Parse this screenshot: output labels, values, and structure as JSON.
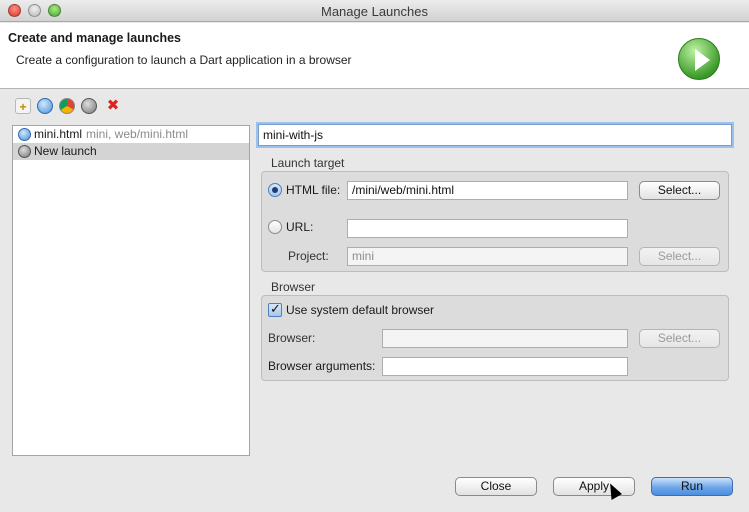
{
  "window": {
    "title": "Manage Launches"
  },
  "header": {
    "title": "Create and manage launches",
    "description": "Create a configuration to launch a Dart application in a browser"
  },
  "toolbar": {
    "icons": [
      "new-launch-icon",
      "dart-launch-icon",
      "chrome-launch-icon",
      "web-launch-icon",
      "delete-icon"
    ],
    "delete_glyph": "✖"
  },
  "launch_list": {
    "items": [
      {
        "name": "mini.html",
        "detail": "mini, web/mini.html",
        "icon": "dart-icon",
        "selected": false
      },
      {
        "name": "New launch",
        "detail": "",
        "icon": "web-icon",
        "selected": true
      }
    ]
  },
  "form": {
    "name_value": "mini-with-js",
    "launch_target": {
      "label": "Launch target",
      "html_file_label": "HTML file:",
      "html_file_value": "/mini/web/mini.html",
      "html_select_label": "Select...",
      "url_label": "URL:",
      "url_value": "",
      "project_label": "Project:",
      "project_value": "mini",
      "project_select_label": "Select..."
    },
    "browser": {
      "label": "Browser",
      "default_checkbox_label": "Use system default browser",
      "browser_label": "Browser:",
      "browser_value": "",
      "browser_select_label": "Select...",
      "args_label": "Browser arguments:",
      "args_value": ""
    }
  },
  "buttons": {
    "close": "Close",
    "apply": "Apply",
    "run": "Run"
  },
  "colors": {
    "accent": "#4c8ee0",
    "run_badge": "#3e9c2a",
    "delete": "#dd2222"
  }
}
